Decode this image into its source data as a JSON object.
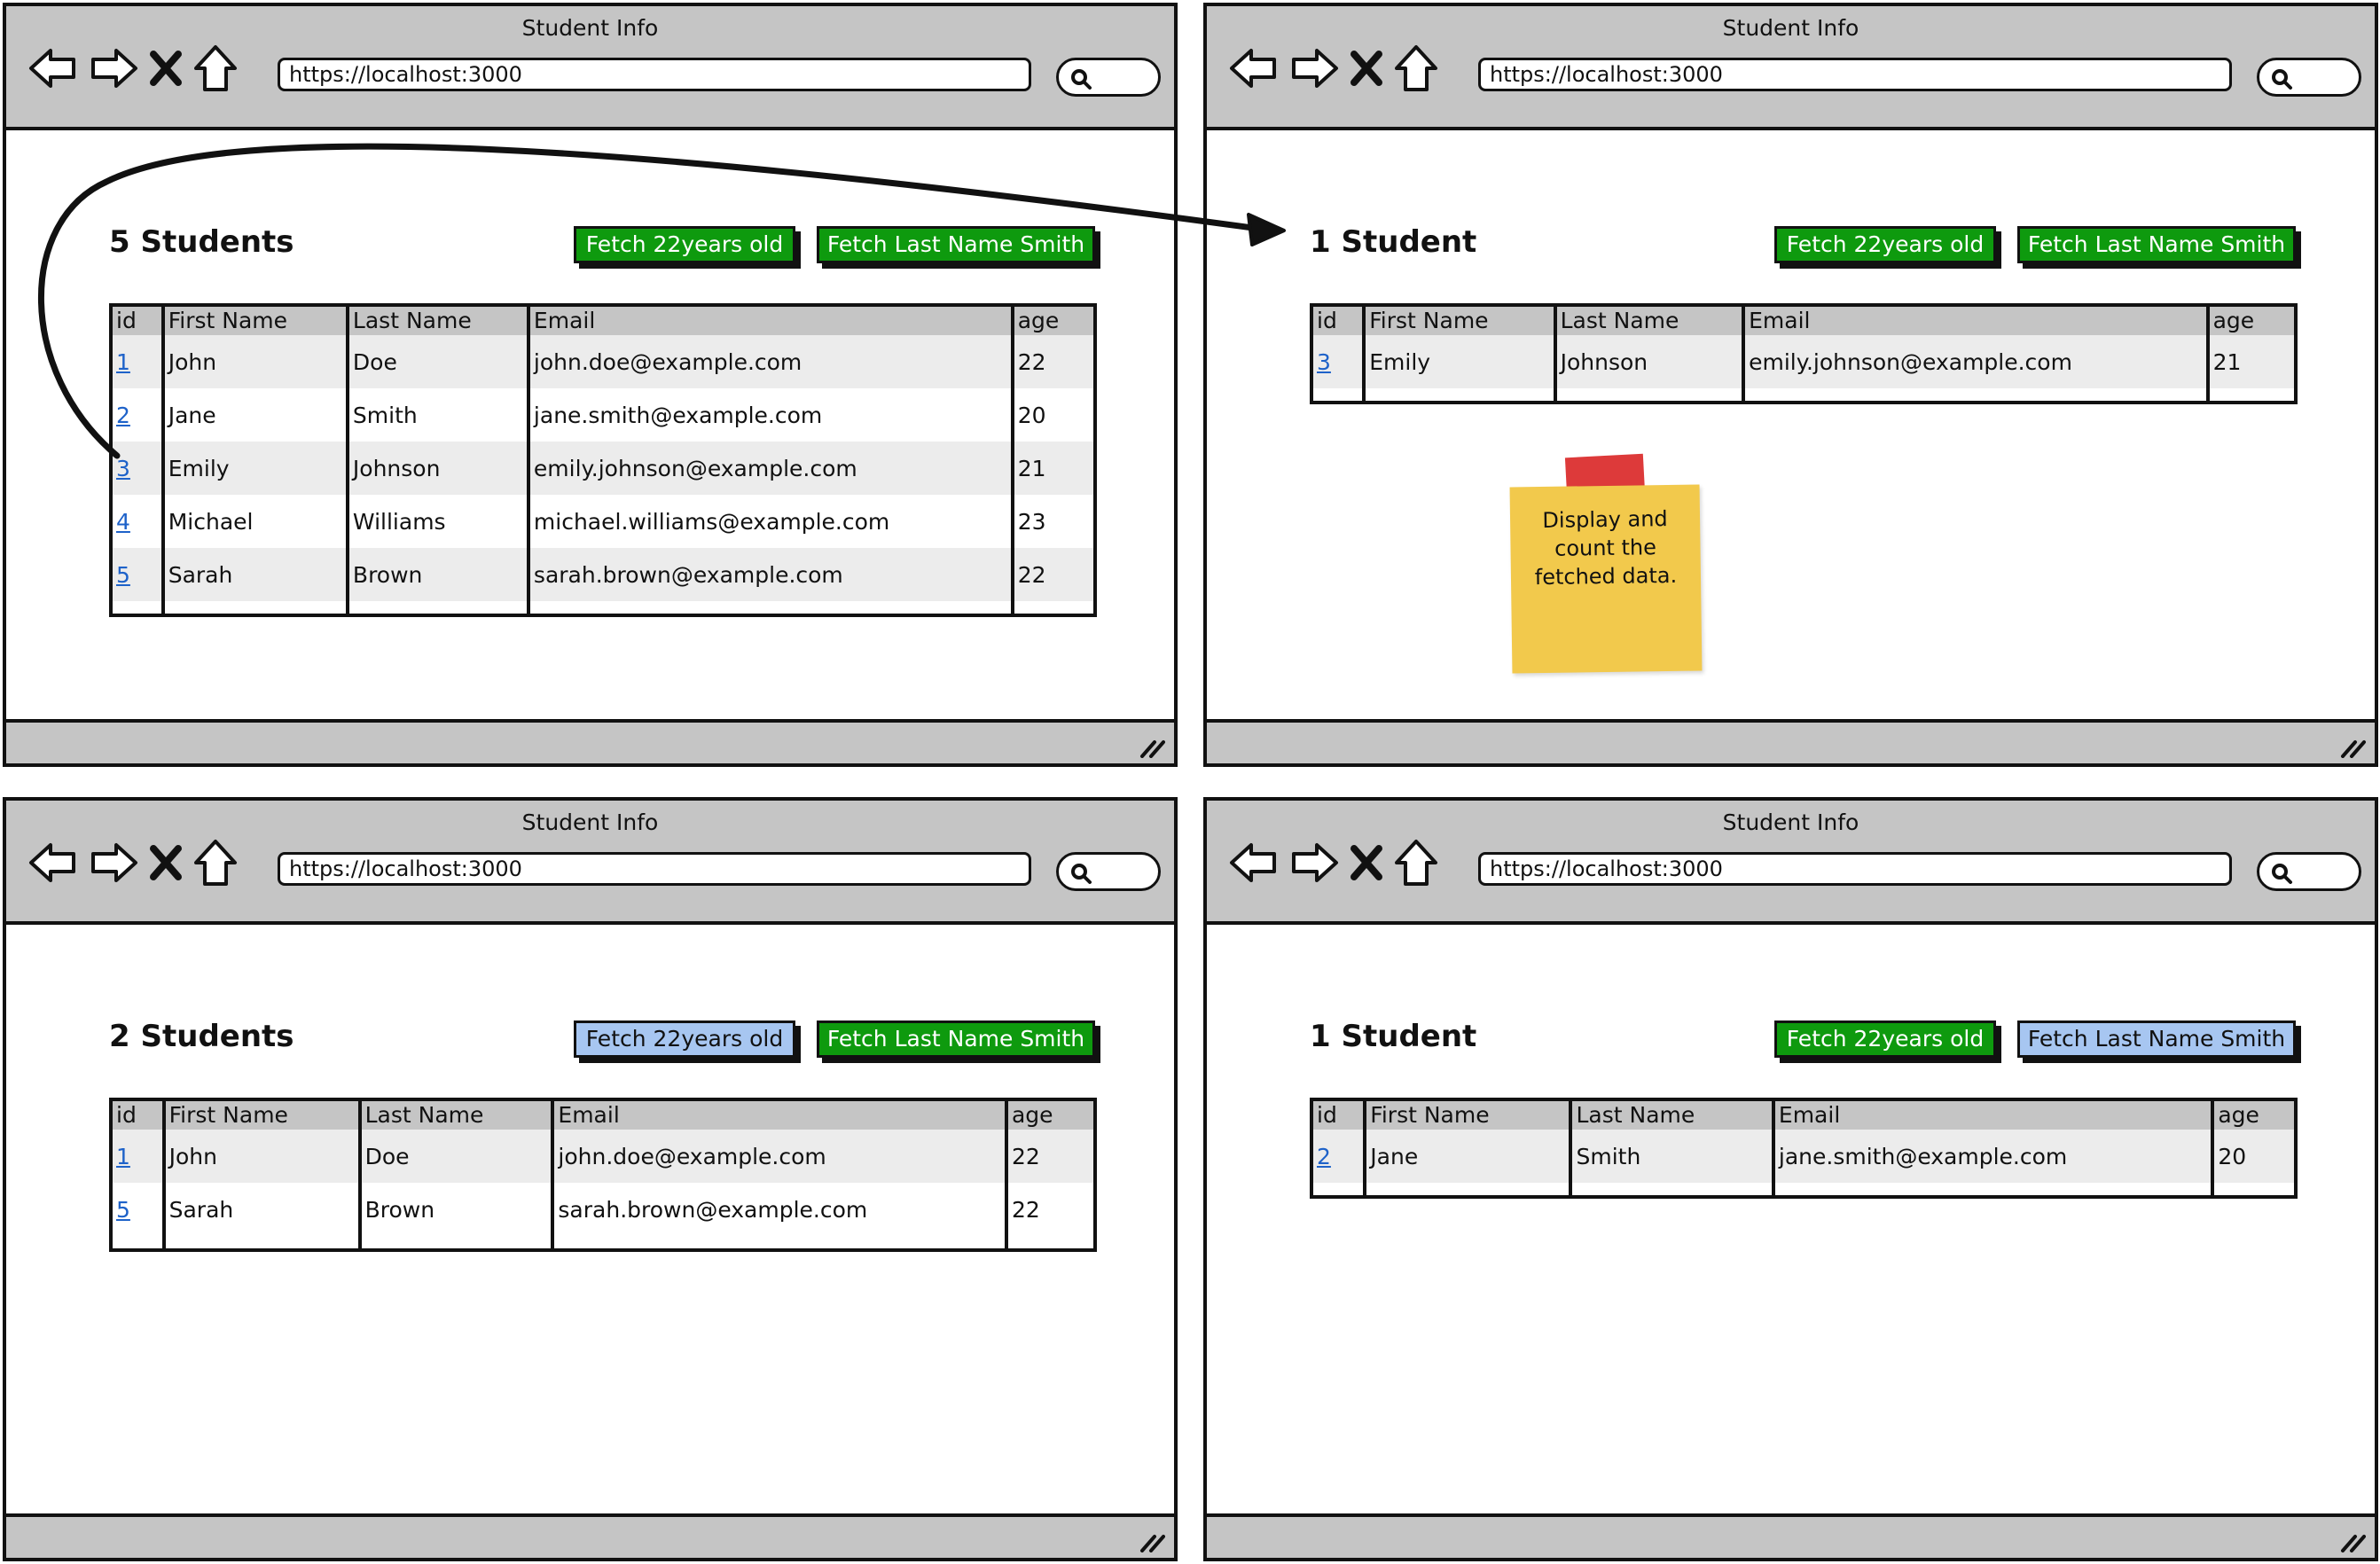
{
  "windows": [
    {
      "title": "Student Info",
      "url": "https://localhost:3000",
      "heading": "5 Students",
      "buttons": {
        "fetch_age": "Fetch 22years old",
        "fetch_smith": "Fetch Last Name Smith"
      },
      "active_button": "none",
      "columns": [
        "id",
        "First Name",
        "Last Name",
        "Email",
        "age"
      ],
      "rows": [
        {
          "id": "1",
          "first": "John",
          "last": "Doe",
          "email": "john.doe@example.com",
          "age": "22"
        },
        {
          "id": "2",
          "first": "Jane",
          "last": "Smith",
          "email": "jane.smith@example.com",
          "age": "20"
        },
        {
          "id": "3",
          "first": "Emily",
          "last": "Johnson",
          "email": "emily.johnson@example.com",
          "age": "21"
        },
        {
          "id": "4",
          "first": "Michael",
          "last": "Williams",
          "email": "michael.williams@example.com",
          "age": "23"
        },
        {
          "id": "5",
          "first": "Sarah",
          "last": "Brown",
          "email": "sarah.brown@example.com",
          "age": "22"
        }
      ]
    },
    {
      "title": "Student Info",
      "url": "https://localhost:3000",
      "heading": "1 Student",
      "buttons": {
        "fetch_age": "Fetch 22years old",
        "fetch_smith": "Fetch Last Name Smith"
      },
      "active_button": "none",
      "columns": [
        "id",
        "First Name",
        "Last Name",
        "Email",
        "age"
      ],
      "rows": [
        {
          "id": "3",
          "first": "Emily",
          "last": "Johnson",
          "email": "emily.johnson@example.com",
          "age": "21"
        }
      ]
    },
    {
      "title": "Student Info",
      "url": "https://localhost:3000",
      "heading": "2 Students",
      "buttons": {
        "fetch_age": "Fetch 22years old",
        "fetch_smith": "Fetch Last Name Smith"
      },
      "active_button": "fetch_age",
      "columns": [
        "id",
        "First Name",
        "Last Name",
        "Email",
        "age"
      ],
      "rows": [
        {
          "id": "1",
          "first": "John",
          "last": "Doe",
          "email": "john.doe@example.com",
          "age": "22"
        },
        {
          "id": "5",
          "first": "Sarah",
          "last": "Brown",
          "email": "sarah.brown@example.com",
          "age": "22"
        }
      ]
    },
    {
      "title": "Student Info",
      "url": "https://localhost:3000",
      "heading": "1 Student",
      "buttons": {
        "fetch_age": "Fetch 22years old",
        "fetch_smith": "Fetch Last Name Smith"
      },
      "active_button": "fetch_smith",
      "columns": [
        "id",
        "First Name",
        "Last Name",
        "Email",
        "age"
      ],
      "rows": [
        {
          "id": "2",
          "first": "Jane",
          "last": "Smith",
          "email": "jane.smith@example.com",
          "age": "20"
        }
      ]
    }
  ],
  "sticky_note": {
    "lines": [
      "Display and",
      "count the",
      "fetched data."
    ],
    "color": "#f2c94c",
    "tape_color": "#dd3a3a"
  },
  "colors": {
    "button_green": "#0e9a0e",
    "button_selected": "#a7c6f1",
    "link_blue": "#1e62c9",
    "chrome_gray": "#c5c5c5"
  },
  "icons": [
    "back-arrow-icon",
    "forward-arrow-icon",
    "close-x-icon",
    "home-icon",
    "search-icon",
    "resize-grip-icon"
  ]
}
